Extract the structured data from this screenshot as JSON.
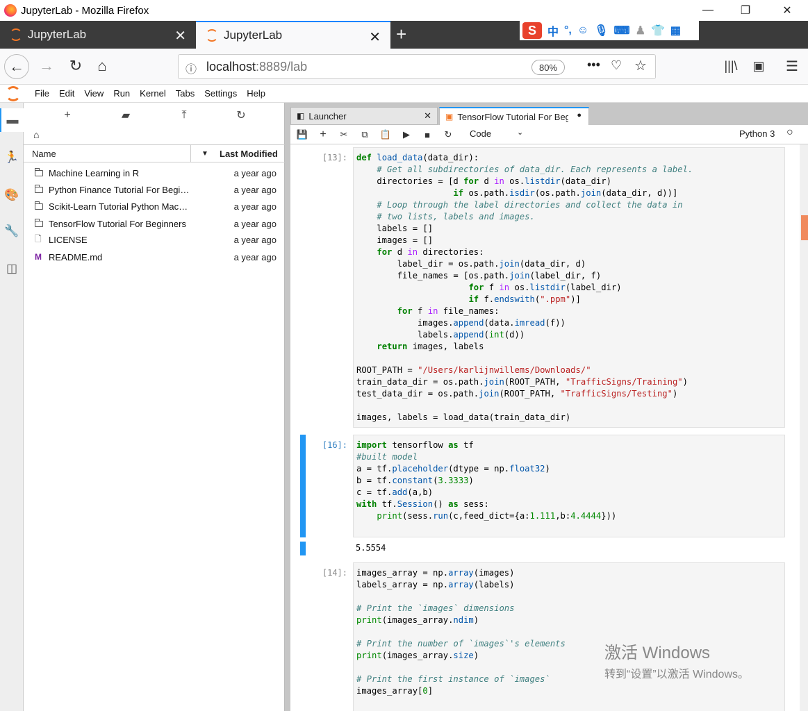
{
  "window": {
    "title": "JupyterLab - Mozilla Firefox"
  },
  "browser_tabs": [
    {
      "label": "JupyterLab"
    },
    {
      "label": "JupyterLab"
    }
  ],
  "url": {
    "host": "localhost",
    "rest": ":8889/lab",
    "zoom": "80%"
  },
  "menu": [
    "File",
    "Edit",
    "View",
    "Run",
    "Kernel",
    "Tabs",
    "Settings",
    "Help"
  ],
  "filebrowser": {
    "col_name": "Name",
    "col_modified": "Last Modified",
    "files": [
      {
        "name": "Machine Learning in R",
        "modified": "a year ago",
        "type": "folder"
      },
      {
        "name": "Python Finance Tutorial For Begi…",
        "modified": "a year ago",
        "type": "folder"
      },
      {
        "name": "Scikit-Learn Tutorial Python Mac…",
        "modified": "a year ago",
        "type": "folder"
      },
      {
        "name": "TensorFlow Tutorial For Beginners",
        "modified": "a year ago",
        "type": "folder"
      },
      {
        "name": "LICENSE",
        "modified": "a year ago",
        "type": "file"
      },
      {
        "name": "README.md",
        "modified": "a year ago",
        "type": "markdown"
      }
    ]
  },
  "doc_tabs": [
    {
      "label": "Launcher"
    },
    {
      "label": "TensorFlow Tutorial For Beg"
    }
  ],
  "toolbar": {
    "cell_type": "Code",
    "kernel": "Python 3"
  },
  "cells": [
    {
      "prompt": "[13]:"
    },
    {
      "prompt": "[16]:"
    },
    {
      "prompt": "[14]:"
    }
  ],
  "output_16": "5.5554",
  "watermark": {
    "line1": "激活 Windows",
    "line2": "转到“设置”以激活 Windows。"
  }
}
